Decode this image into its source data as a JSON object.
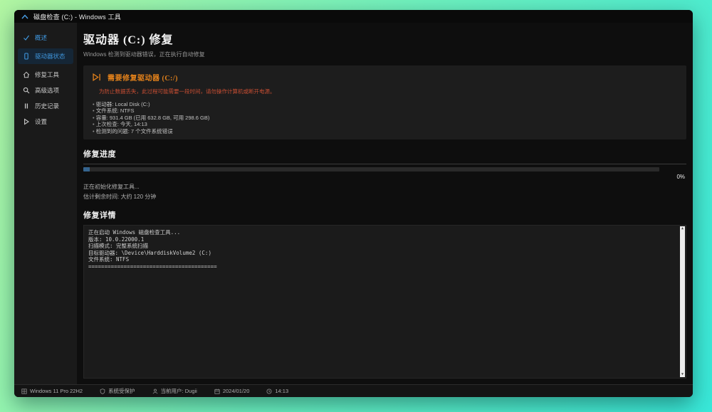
{
  "window": {
    "title": "磁盘检查 (C:) - Windows 工具"
  },
  "sidebar": {
    "items": [
      {
        "label": "概述",
        "icon": "check-icon"
      },
      {
        "label": "驱动器状态",
        "icon": "drive-icon"
      },
      {
        "label": "修复工具",
        "icon": "home-icon"
      },
      {
        "label": "高级选项",
        "icon": "search-icon"
      },
      {
        "label": "历史记录",
        "icon": "history-icon"
      },
      {
        "label": "设置",
        "icon": "settings-icon"
      }
    ]
  },
  "main": {
    "title": "驱动器 (C:) 修复",
    "subtitle": "Windows 检测到驱动器错误，正在执行自动修复",
    "warning": {
      "title": "需要修复驱动器 (C:/)",
      "message": "为防止数据丢失，此过程可能需要一段时间，请勿操作计算机或断开电源。",
      "details": [
        "驱动器: Local Disk (C:)",
        "文件系统: NTFS",
        "容量: 931.4 GB (已用 632.8 GB, 可用 298.6 GB)",
        "上次检查: 今天, 14:13",
        "检测到的问题: 7 个文件系统错误"
      ]
    },
    "progress": {
      "title": "修复进度",
      "percent": "0%",
      "status": "正在初始化修复工具...",
      "eta": "估计剩余时间: 大约 120 分钟"
    },
    "details": {
      "title": "修复详情",
      "log_lines": [
        "正在启动 Windows 磁盘检查工具...",
        "版本: 10.0.22000.1",
        "扫描模式: 完整系统扫描",
        "目标驱动器: \\Device\\HarddiskVolume2 (C:)",
        "文件系统: NTFS",
        "========================================"
      ]
    }
  },
  "statusbar": {
    "items": [
      {
        "label": "Windows 11 Pro 22H2",
        "icon": "windows-icon"
      },
      {
        "label": "系统受保护",
        "icon": "shield-icon"
      },
      {
        "label": "当前用户: Dugii",
        "icon": "user-icon"
      },
      {
        "label": "2024/01/20",
        "icon": "calendar-icon"
      },
      {
        "label": "14:13",
        "icon": "clock-icon"
      }
    ]
  },
  "colors": {
    "accent_blue": "#3f96dd",
    "warning_orange": "#e2811b",
    "warning_red": "#c94e33"
  }
}
